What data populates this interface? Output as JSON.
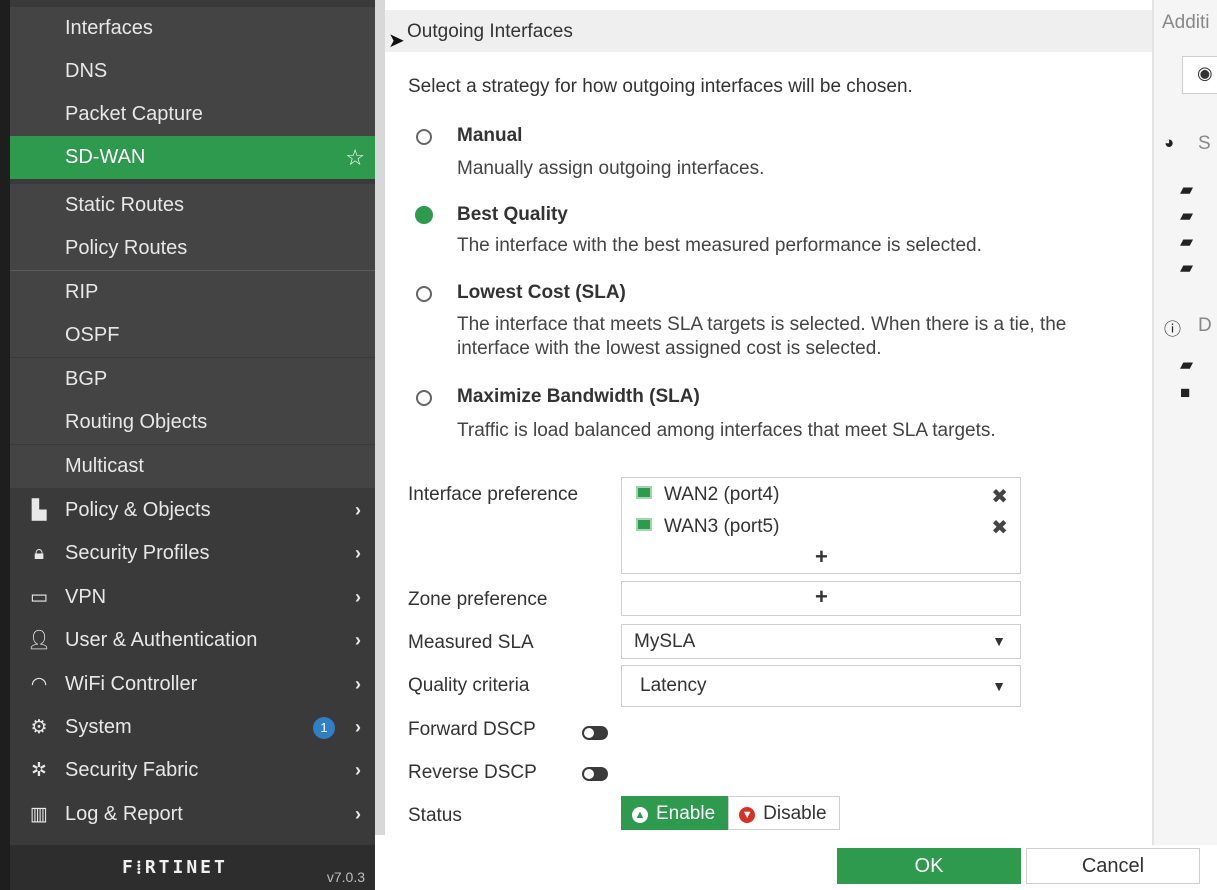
{
  "sidebar": {
    "network_subitems": [
      {
        "label": "Interfaces"
      },
      {
        "label": "DNS"
      },
      {
        "label": "Packet Capture"
      },
      {
        "label": "SD-WAN",
        "active": true
      },
      {
        "label": "Static Routes"
      },
      {
        "label": "Policy Routes"
      },
      {
        "label": "RIP"
      },
      {
        "label": "OSPF"
      },
      {
        "label": "BGP"
      },
      {
        "label": "Routing Objects"
      },
      {
        "label": "Multicast"
      }
    ],
    "menu": [
      {
        "label": "Policy & Objects",
        "icon": "policy-icon"
      },
      {
        "label": "Security Profiles",
        "icon": "lock-icon"
      },
      {
        "label": "VPN",
        "icon": "laptop-icon"
      },
      {
        "label": "User & Authentication",
        "icon": "user-icon"
      },
      {
        "label": "WiFi Controller",
        "icon": "wifi-icon"
      },
      {
        "label": "System",
        "icon": "gear-icon",
        "badge": "1"
      },
      {
        "label": "Security Fabric",
        "icon": "fabric-icon"
      },
      {
        "label": "Log & Report",
        "icon": "chart-icon"
      }
    ],
    "logo": "F⁞RTINET",
    "version": "v7.0.3"
  },
  "section": {
    "title": "Outgoing Interfaces",
    "strategy_desc": "Select a strategy for how outgoing interfaces will be chosen."
  },
  "options": [
    {
      "title": "Manual",
      "desc": "Manually assign outgoing interfaces.",
      "checked": false
    },
    {
      "title": "Best Quality",
      "desc": "The interface with the best measured performance is selected.",
      "checked": true
    },
    {
      "title": "Lowest Cost (SLA)",
      "desc": "The interface that meets SLA targets is selected. When there is a tie, the interface with the lowest assigned cost is selected.",
      "checked": false
    },
    {
      "title": "Maximize Bandwidth (SLA)",
      "desc": "Traffic is load balanced among interfaces that meet SLA targets.",
      "checked": false
    }
  ],
  "form": {
    "interface_pref_label": "Interface preference",
    "interfaces": [
      "WAN2 (port4)",
      "WAN3 (port5)"
    ],
    "add_symbol": "+",
    "remove_symbol": "✖",
    "zone_pref_label": "Zone preference",
    "measured_sla_label": "Measured SLA",
    "measured_sla_value": "MySLA",
    "quality_label": "Quality criteria",
    "quality_value": "Latency",
    "forward_dscp_label": "Forward DSCP",
    "reverse_dscp_label": "Reverse DSCP",
    "status_label": "Status",
    "enable_label": "Enable",
    "disable_label": "Disable"
  },
  "footer": {
    "ok": "OK",
    "cancel": "Cancel"
  },
  "right_panel": {
    "title": "Additi",
    "s_text": "S",
    "d_text": "D"
  },
  "colors": {
    "accent_green": "#2e9a4d",
    "sidebar_bg": "#3a3a3a",
    "badge_blue": "#2f7fc4",
    "disable_red": "#d93025"
  }
}
